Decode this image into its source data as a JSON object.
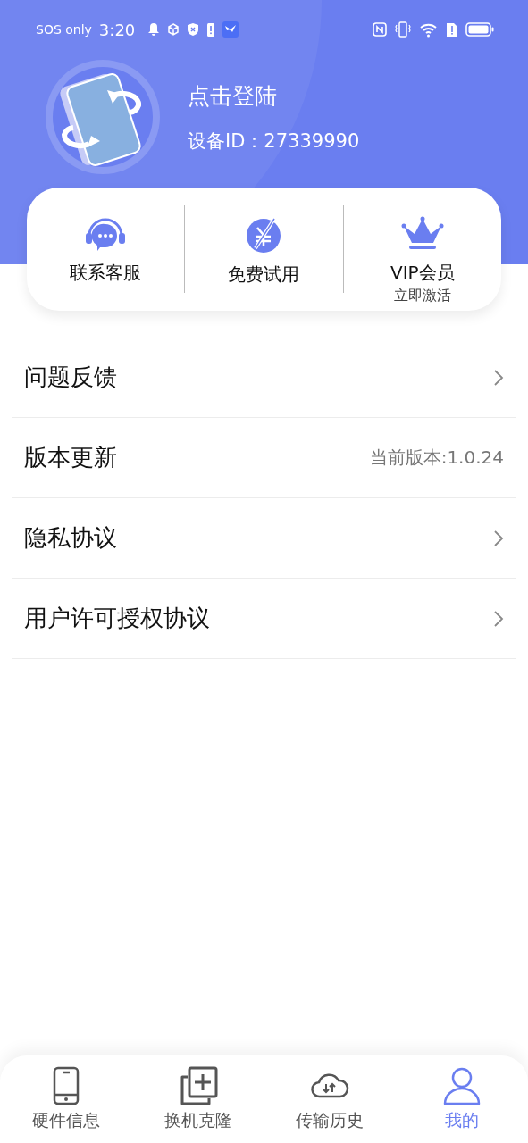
{
  "status_bar": {
    "carrier": "SOS only",
    "time": "3:20"
  },
  "profile": {
    "title": "点击登陆",
    "device_id": "设备ID：27339990"
  },
  "quick_actions": [
    {
      "kind": "support",
      "label": "联系客服"
    },
    {
      "kind": "trial",
      "label": "免费试用"
    },
    {
      "kind": "vip",
      "label": "VIP会员",
      "sublabel": "立即激活"
    }
  ],
  "menu": [
    {
      "kind": "link",
      "label": "问题反馈"
    },
    {
      "kind": "info",
      "label": "版本更新",
      "value": "当前版本:1.0.24"
    },
    {
      "kind": "link",
      "label": "隐私协议"
    },
    {
      "kind": "link",
      "label": "用户许可授权协议"
    }
  ],
  "nav": [
    {
      "kind": "phone",
      "label": "硬件信息",
      "selected": false
    },
    {
      "kind": "clone",
      "label": "换机克隆",
      "selected": false
    },
    {
      "kind": "cloud",
      "label": "传输历史",
      "selected": false
    },
    {
      "kind": "user",
      "label": "我的",
      "selected": true
    }
  ]
}
